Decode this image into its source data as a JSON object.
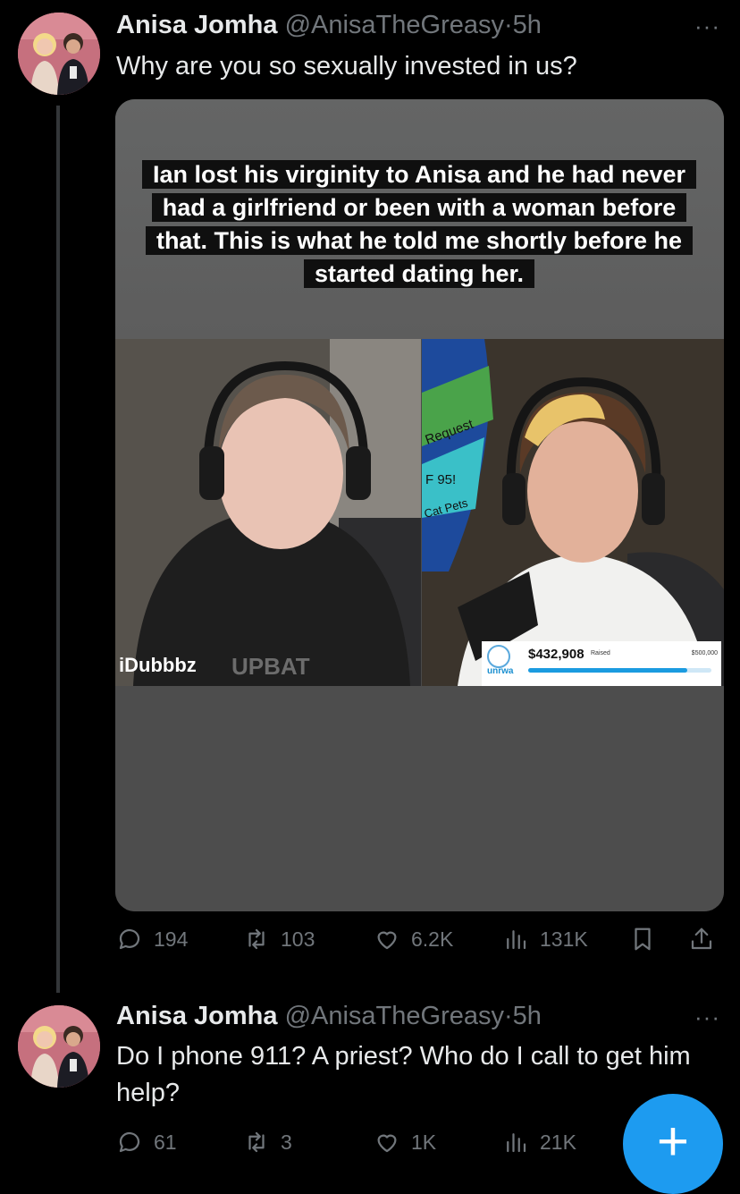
{
  "tweets": [
    {
      "author_name": "Anisa Jomha",
      "handle": "@AnisaTheGreasy",
      "separator": "·",
      "time": "5h",
      "text": "Why are you so sexually invested in us?",
      "media": {
        "caption": "Ian lost his virginity to Anisa and he had never had a girlfriend or been with a woman before that. This is what he told me shortly before he started dating her.",
        "streamer_label": "iDubbbz",
        "shirt_text": "UPBAT",
        "wheel_labels": [
          "Request",
          "F 95!",
          "Cat Pets"
        ],
        "donation_amount": "$432,908",
        "donation_raised_label": "Raised",
        "donation_goal": "$500,000",
        "donation_org": "unrwa",
        "donation_progress": 0.866
      },
      "replies": "194",
      "reposts": "103",
      "likes": "6.2K",
      "views": "131K"
    },
    {
      "author_name": "Anisa Jomha",
      "handle": "@AnisaTheGreasy",
      "separator": "·",
      "time": "5h",
      "text": "Do I phone 911? A priest? Who do I call to get him help?",
      "replies": "61",
      "reposts": "3",
      "likes": "1K",
      "views": "21K"
    }
  ],
  "more_label": "···",
  "fab_label": "+",
  "colors": {
    "accent": "#1d9bf0",
    "muted": "#71767b",
    "text": "#e7e9ea",
    "background": "#000000"
  }
}
